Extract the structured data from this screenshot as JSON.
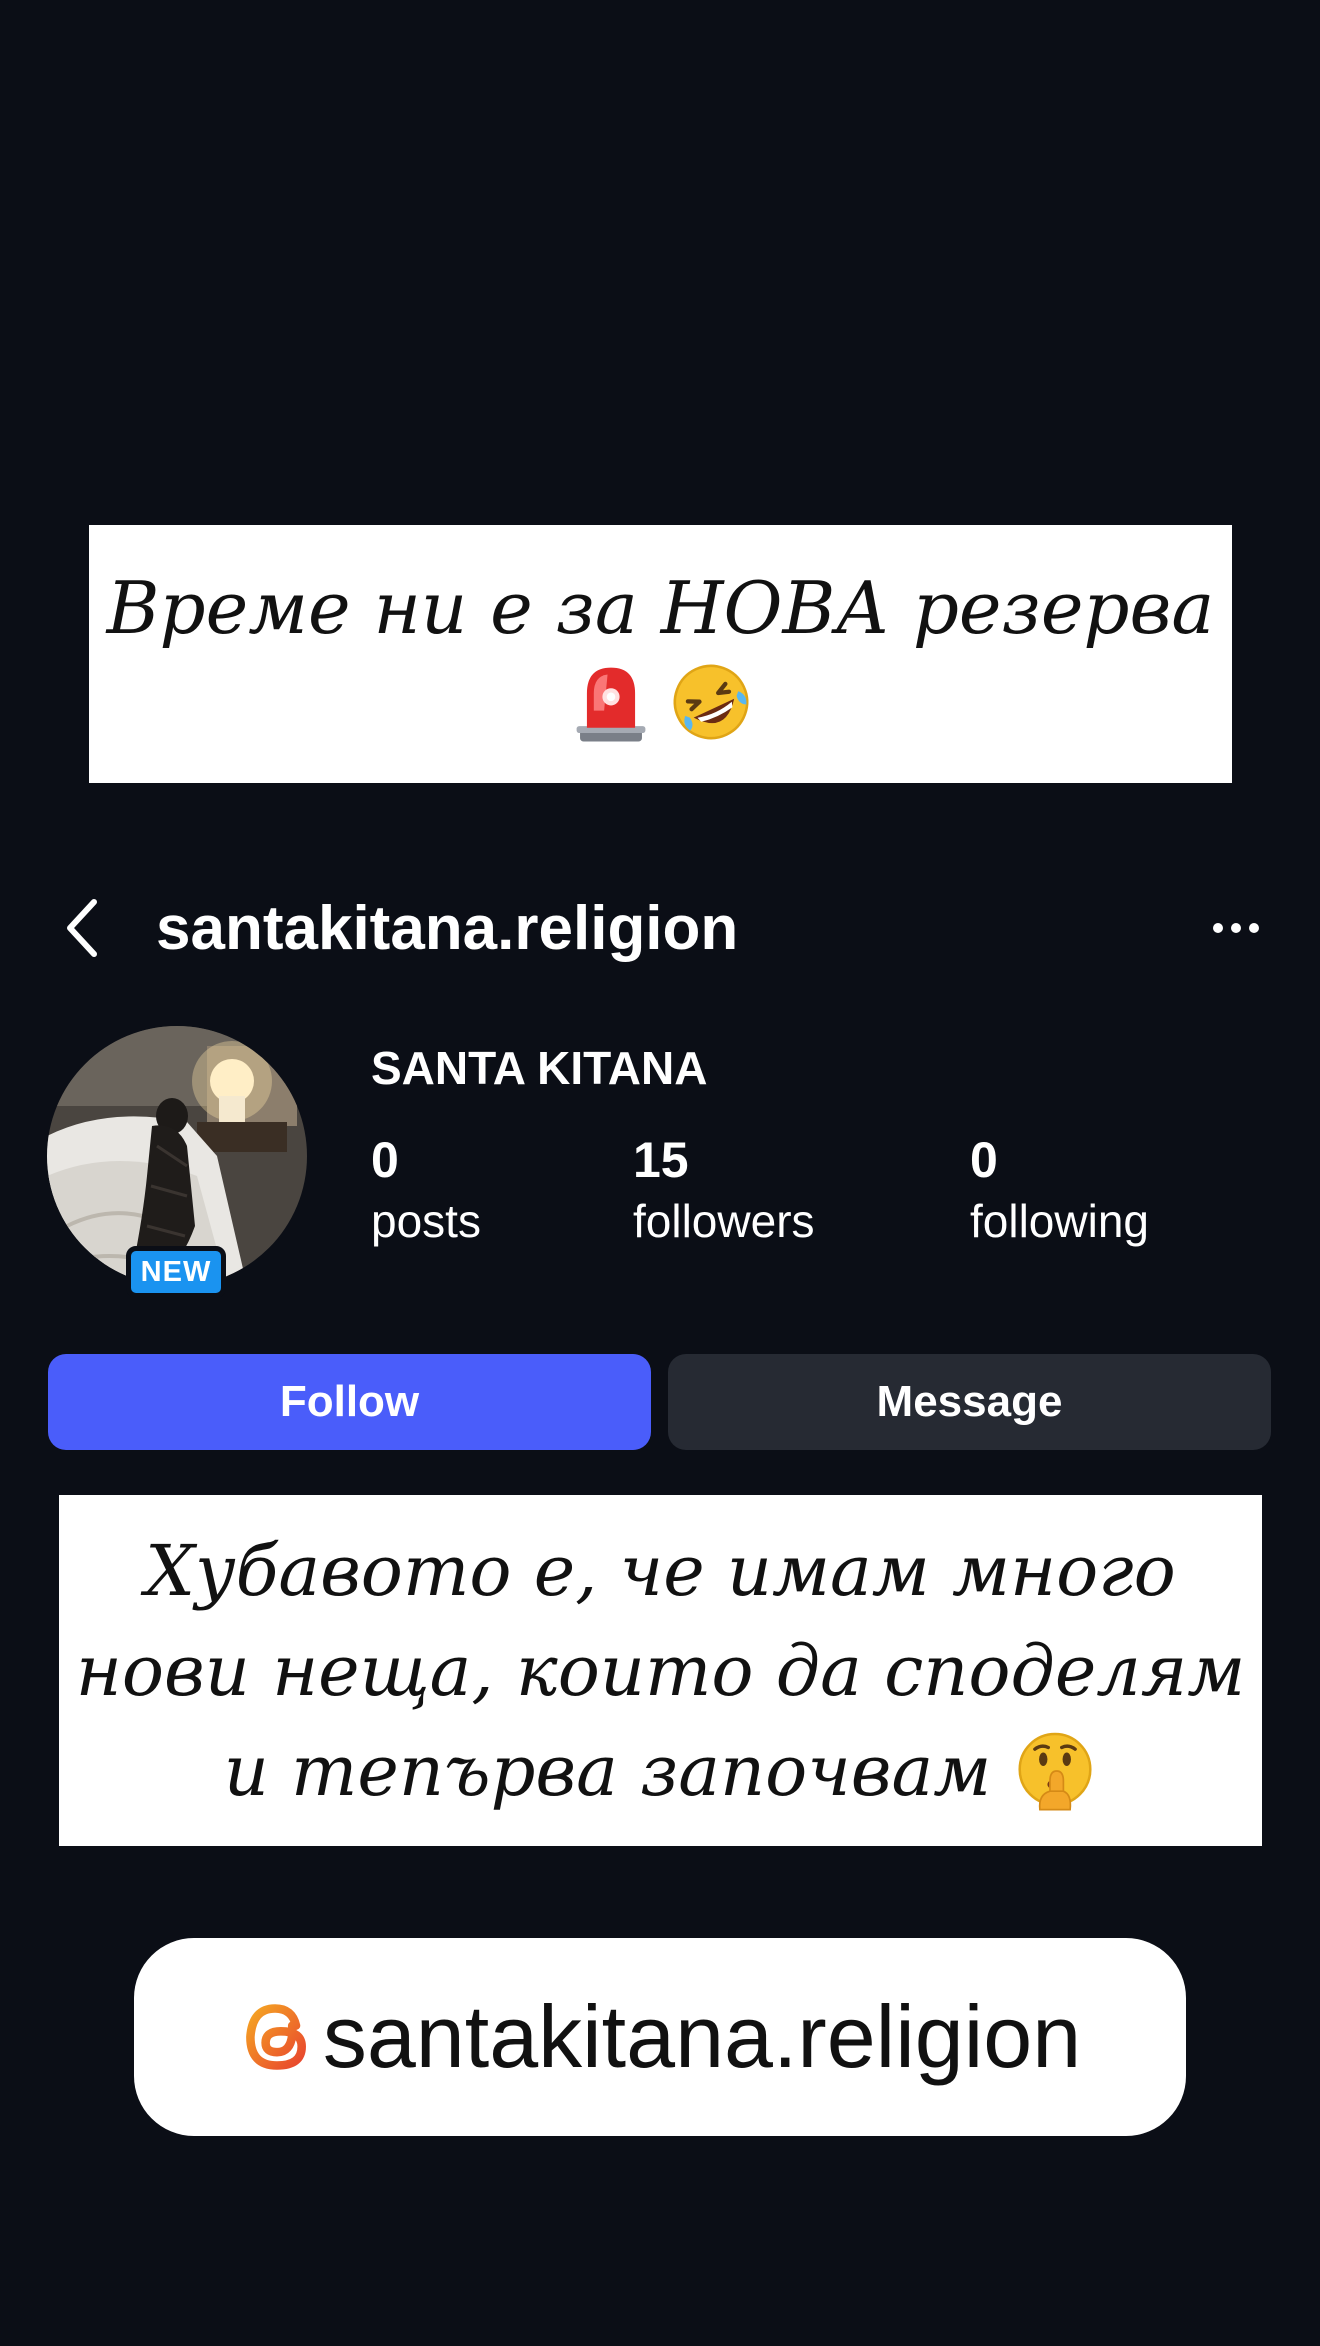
{
  "caption_top": {
    "line1": "Време ни е за НОВА резерва",
    "emojis": [
      "siren-emoji",
      "rolling-laughing-emoji"
    ]
  },
  "profile": {
    "username": "santakitana.religion",
    "display_name": "SANTA KITANA",
    "new_badge": "NEW",
    "stats": {
      "posts": {
        "value": "0",
        "label": "posts"
      },
      "followers": {
        "value": "15",
        "label": "followers"
      },
      "following": {
        "value": "0",
        "label": "following"
      }
    }
  },
  "buttons": {
    "follow": "Follow",
    "message": "Message"
  },
  "caption_mid": {
    "line1": "Хубавото е, че имам много",
    "line2": "нови неща, които да споделям",
    "line3": "и тепърва започвам",
    "emoji": "shushing-face-emoji"
  },
  "threads_sticker": {
    "handle": "santakitana.religion",
    "icon": "threads-icon"
  },
  "colors": {
    "background": "#0b0e16",
    "follow_button": "#4a5dfa",
    "message_button": "#262a33",
    "new_badge": "#1a93f0",
    "threads_gradient_start": "#f5a623",
    "threads_gradient_end": "#e8452e"
  }
}
